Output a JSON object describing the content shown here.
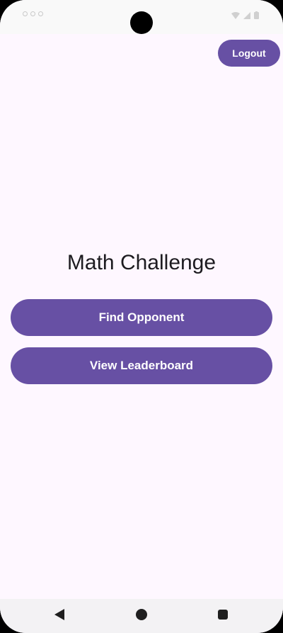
{
  "app": {
    "title": "Math Challenge"
  },
  "header": {
    "logout_label": "Logout"
  },
  "main": {
    "find_opponent_label": "Find Opponent",
    "view_leaderboard_label": "View Leaderboard"
  },
  "icons": {
    "status_left": [
      "status-indicator-icon",
      "status-indicator-icon",
      "status-indicator-icon"
    ],
    "status_right": [
      "wifi-icon",
      "signal-icon",
      "battery-icon"
    ],
    "nav": [
      "back-icon",
      "home-icon",
      "recents-icon"
    ]
  },
  "colors": {
    "primary": "#6750A4",
    "background": "#FEF7FF",
    "on_primary": "#FFFFFF",
    "title_text": "#1D1B20"
  }
}
